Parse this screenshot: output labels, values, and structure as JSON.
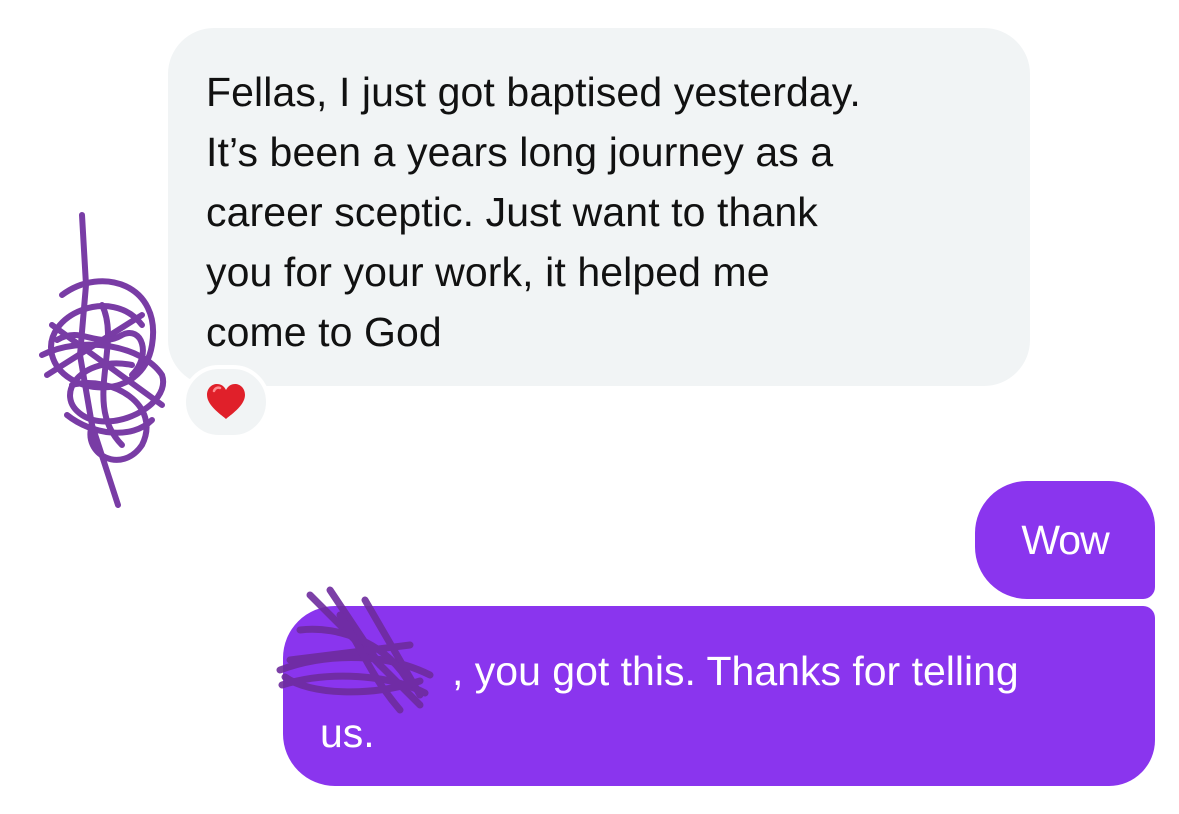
{
  "conversation": {
    "incoming": {
      "lines": [
        "Fellas, I just got baptised yesterday.",
        "It’s been a years long journey as a",
        "career sceptic. Just want to thank",
        "you for your work, it helped me",
        "come to God"
      ],
      "reaction": "heart-emoji"
    },
    "outgoing": [
      {
        "text": "Wow"
      },
      {
        "lines": [
          ", you got this. Thanks for telling",
          "us."
        ]
      }
    ]
  },
  "colors": {
    "outgoing_bubble": "#8a35ee",
    "incoming_bubble": "#f1f4f5",
    "scribble": "#6e2c9e",
    "heart": "#e0202a"
  }
}
